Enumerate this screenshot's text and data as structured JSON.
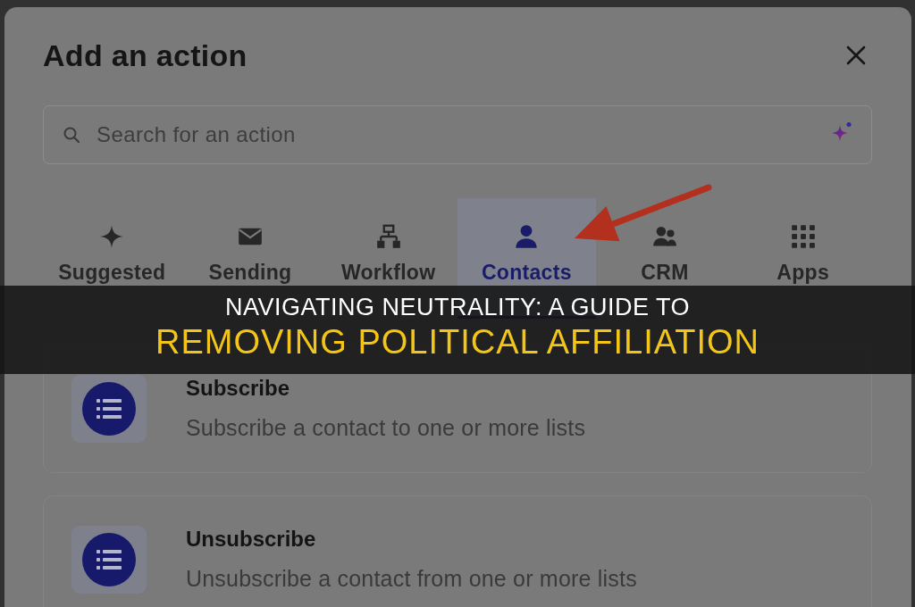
{
  "dialog": {
    "title": "Add an action"
  },
  "search": {
    "placeholder": "Search for an action"
  },
  "tabs": [
    {
      "label": "Suggested",
      "selected": false
    },
    {
      "label": "Sending",
      "selected": false
    },
    {
      "label": "Workflow",
      "selected": false
    },
    {
      "label": "Contacts",
      "selected": true
    },
    {
      "label": "CRM",
      "selected": false
    },
    {
      "label": "Apps",
      "selected": false
    }
  ],
  "actions": [
    {
      "title": "Subscribe",
      "description": "Subscribe a contact to one or more lists"
    },
    {
      "title": "Unsubscribe",
      "description": "Unsubscribe a contact from one or more lists"
    }
  ],
  "banner": {
    "overline": "NAVIGATING NEUTRALITY: A GUIDE TO",
    "headline": "REMOVING POLITICAL AFFILIATION"
  }
}
